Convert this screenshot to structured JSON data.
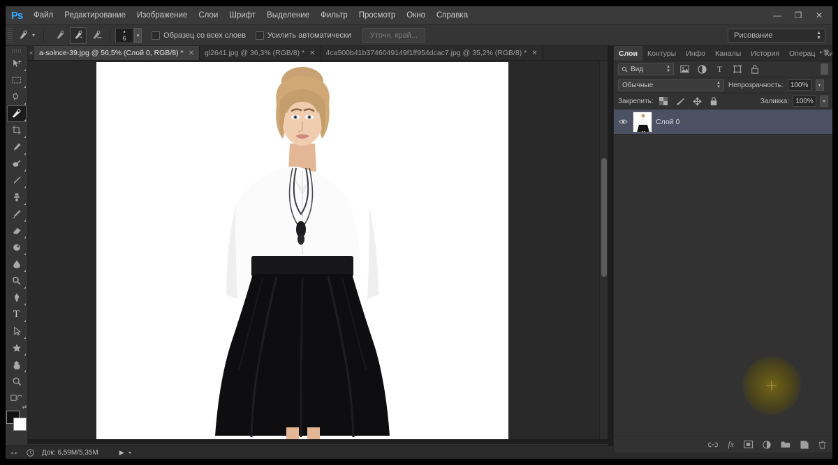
{
  "app": {
    "title": "Adobe Photoshop",
    "logo_text": "Ps"
  },
  "window_controls": {
    "minimize": "—",
    "restore": "❐",
    "close": "✕"
  },
  "menubar": {
    "items": [
      {
        "label": "Файл"
      },
      {
        "label": "Редактирование"
      },
      {
        "label": "Изображение"
      },
      {
        "label": "Слои"
      },
      {
        "label": "Шрифт"
      },
      {
        "label": "Выделение"
      },
      {
        "label": "Фильтр"
      },
      {
        "label": "Просмотр"
      },
      {
        "label": "Окно"
      },
      {
        "label": "Справка"
      }
    ]
  },
  "options_bar": {
    "brush_size_value": "6",
    "sample_all_layers_label": "Образец со всех слоев",
    "sample_all_layers_checked": false,
    "auto_enhance_label": "Усилить автоматически",
    "auto_enhance_checked": false,
    "refine_edge_label": "Уточн. край...",
    "selection_modes": [
      "new-selection",
      "add-to-selection",
      "subtract-from-selection"
    ],
    "active_selection_mode": "add-to-selection"
  },
  "workspace": {
    "selected": "Рисование"
  },
  "document_tabs": [
    {
      "label": "a-solnce-39.jpg @ 56,5% (Слой 0, RGB/8) *",
      "active": true,
      "close": "✕"
    },
    {
      "label": "gl2641.jpg @ 36,3% (RGB/8) *",
      "active": false,
      "close": "✕"
    },
    {
      "label": "4ca500b41b3746049149f1ff954dcac7.jpg @ 35,2% (RGB/8) *",
      "active": false,
      "close": "✕"
    }
  ],
  "toolbar": {
    "tools": [
      {
        "name": "move-tool",
        "active": false
      },
      {
        "name": "rectangular-marquee-tool",
        "active": false
      },
      {
        "name": "lasso-tool",
        "active": false
      },
      {
        "name": "quick-selection-tool",
        "active": true
      },
      {
        "name": "crop-tool",
        "active": false
      },
      {
        "name": "eyedropper-tool",
        "active": false
      },
      {
        "name": "healing-brush-tool",
        "active": false
      },
      {
        "name": "brush-tool",
        "active": false
      },
      {
        "name": "clone-stamp-tool",
        "active": false
      },
      {
        "name": "history-brush-tool",
        "active": false
      },
      {
        "name": "eraser-tool",
        "active": false
      },
      {
        "name": "gradient-tool",
        "active": false
      },
      {
        "name": "blur-tool",
        "active": false
      },
      {
        "name": "dodge-tool",
        "active": false
      },
      {
        "name": "pen-tool",
        "active": false
      },
      {
        "name": "type-tool",
        "active": false,
        "glyph": "T"
      },
      {
        "name": "path-selection-tool",
        "active": false
      },
      {
        "name": "shape-tool",
        "active": false
      },
      {
        "name": "hand-tool",
        "active": false
      },
      {
        "name": "zoom-tool",
        "active": false
      }
    ],
    "foreground_color": "#111111",
    "background_color": "#ffffff"
  },
  "panels": {
    "tabs": [
      {
        "label": "Слои",
        "active": true
      },
      {
        "label": "Контуры",
        "active": false
      },
      {
        "label": "Инфо",
        "active": false
      },
      {
        "label": "Каналы",
        "active": false
      },
      {
        "label": "История",
        "active": false
      },
      {
        "label": "Операц",
        "active": false
      },
      {
        "label": "Кисть",
        "active": false
      }
    ],
    "layers": {
      "filter_label": "Вид",
      "filter_icons": [
        "pixel-filter-icon",
        "adjustment-filter-icon",
        "type-filter-icon",
        "shape-filter-icon",
        "smart-object-filter-icon"
      ],
      "blend_mode": "Обычные",
      "opacity_label": "Непрозрачность:",
      "opacity_value": "100%",
      "lock_label": "Закрепить:",
      "fill_label": "Заливка:",
      "fill_value": "100%",
      "rows": [
        {
          "name": "Слой 0",
          "visible": true,
          "selected": true
        }
      ],
      "footer_icons": [
        "link-layers-icon",
        "add-layer-style-icon",
        "add-layer-mask-icon",
        "new-adjustment-layer-icon",
        "new-group-icon",
        "new-layer-icon",
        "delete-layer-icon"
      ]
    }
  },
  "status_bar": {
    "doc_label": "Док: 6,59M/5,35M",
    "play_arrow": "▶"
  },
  "colors": {
    "accent_blue": "#31a8ff",
    "panel_bg": "#323232",
    "chrome_bg": "#353535",
    "canvas_bg": "#292929",
    "selected_layer": "#4b5163",
    "cursor_glow": "#7e6c0e"
  }
}
